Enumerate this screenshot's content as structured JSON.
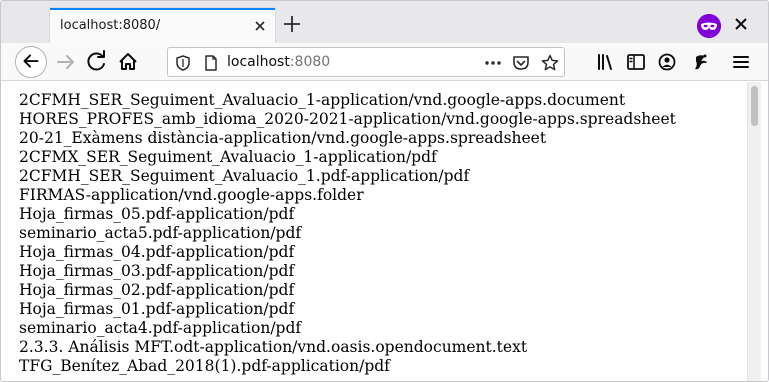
{
  "tab": {
    "title": "localhost:8080/"
  },
  "urlbar": {
    "host": "localhost",
    "port": ":8080"
  },
  "icons": {
    "tab_close": "close-icon",
    "new_tab": "plus-icon",
    "private": "private-browsing-mask-icon",
    "window_close": "close-icon",
    "back": "back-arrow-icon",
    "forward": "forward-arrow-icon",
    "reload": "reload-icon",
    "home": "home-icon",
    "tracking": "shield-icon",
    "page": "page-icon",
    "page_actions": "more-horizontal-icon",
    "pocket": "pocket-icon",
    "bookmark": "star-icon",
    "library": "library-icon",
    "sidebar": "sidebar-icon",
    "account": "account-icon",
    "extension": "extension-icon",
    "menu": "hamburger-menu-icon"
  },
  "colors": {
    "accent": "#0a84ff",
    "private": "#8000d7"
  },
  "content": {
    "lines": [
      "2CFMH_SER_Seguiment_Avaluacio_1-application/vnd.google-apps.document",
      "HORES_PROFES_amb_idioma_2020-2021-application/vnd.google-apps.spreadsheet",
      "20-21_Exàmens distància-application/vnd.google-apps.spreadsheet",
      "2CFMX_SER_Seguiment_Avaluacio_1-application/pdf",
      "2CFMH_SER_Seguiment_Avaluacio_1.pdf-application/pdf",
      "FIRMAS-application/vnd.google-apps.folder",
      "Hoja_firmas_05.pdf-application/pdf",
      "seminario_acta5.pdf-application/pdf",
      "Hoja_firmas_04.pdf-application/pdf",
      "Hoja_firmas_03.pdf-application/pdf",
      "Hoja_firmas_02.pdf-application/pdf",
      "Hoja_firmas_01.pdf-application/pdf",
      "seminario_acta4.pdf-application/pdf",
      "2.3.3. Análisis MFT.odt-application/vnd.oasis.opendocument.text",
      "TFG_Benítez_Abad_2018(1).pdf-application/pdf"
    ]
  }
}
